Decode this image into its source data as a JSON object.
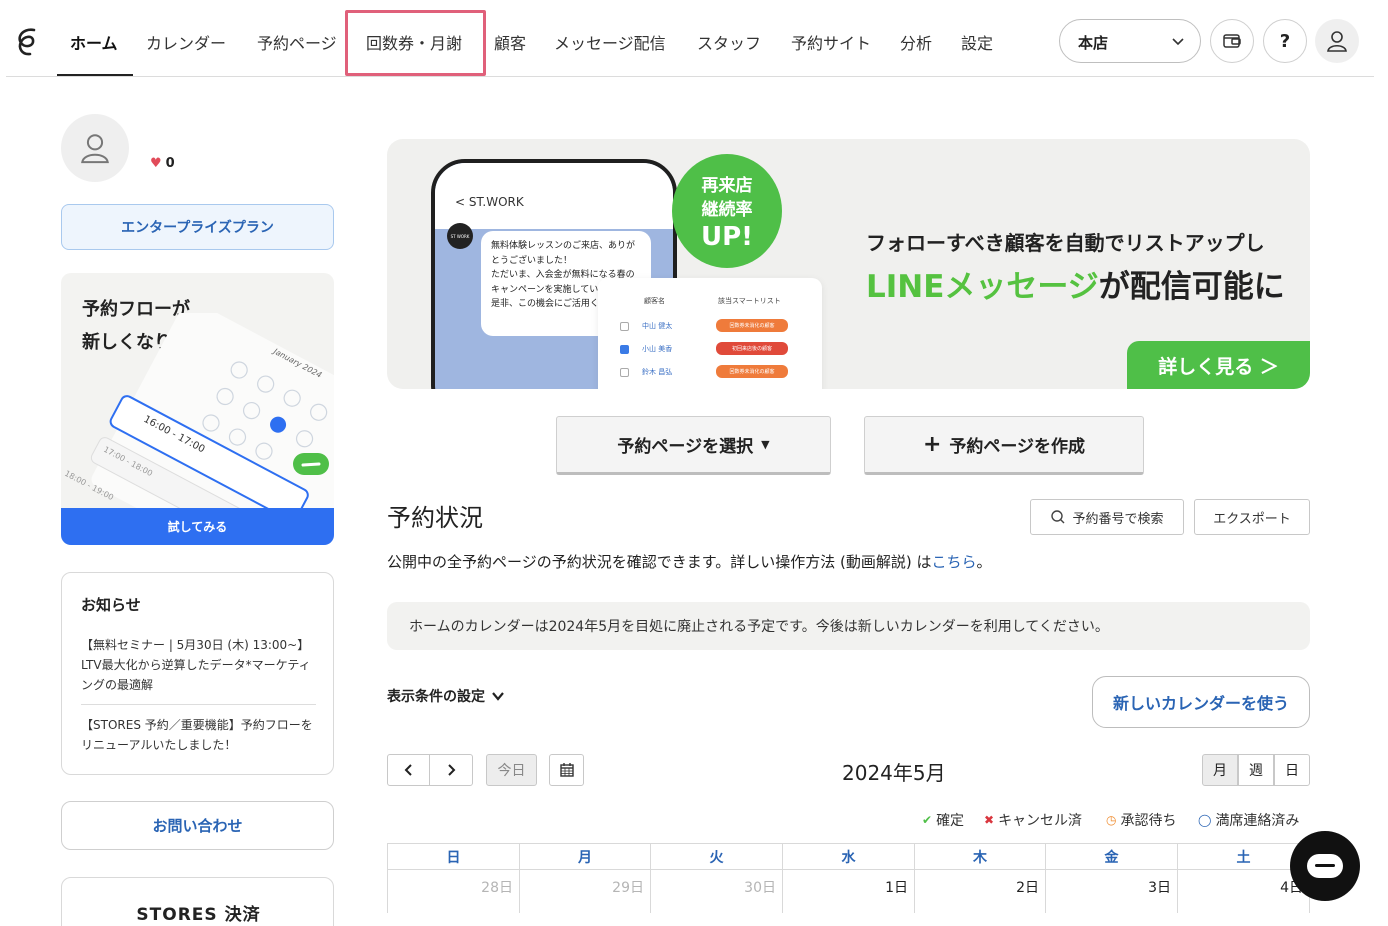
{
  "nav": {
    "items": [
      "ホーム",
      "カレンダー",
      "予約ページ",
      "回数券・月謝",
      "顧客",
      "メッセージ配信",
      "スタッフ",
      "予約サイト",
      "分析",
      "設定"
    ],
    "store_select": "本店",
    "help_label": "?"
  },
  "sidebar": {
    "likes": "0",
    "plan": "エンタープライズプラン",
    "promo": {
      "title_line1": "予約フローが",
      "title_line2": "新しくなりました",
      "art_date": "January 2024",
      "art_slot1": "16:00 - 17:00",
      "art_slot2": "17:00 - 18:00",
      "art_slot3": "18:00 - 19:00",
      "cta": "試してみる"
    },
    "news": {
      "heading": "お知らせ",
      "item1": "【無料セミナー | 5月30日 (木) 13:00~】LTV最大化から逆算したデータ*マーケティングの最適解",
      "item2": "【STORES 予約／重要機能】予約フローをリニューアルいたしました！"
    },
    "contact": "お問い合わせ",
    "stores_card_title": "STORES 決済"
  },
  "banner": {
    "phone_back": "ST.WORK",
    "phone_icon": "ST WORK",
    "bubble_lines": [
      "無料体験レッスンのご来店、ありがとうございました！",
      "ただいま、入会金が無料になる春のキャンペーンを実施しています。",
      "是非、この機会にご活用ください。"
    ],
    "circle_line1": "再来店",
    "circle_line2": "継続率",
    "circle_line3": "UP!",
    "list_head_name": "顧客名",
    "list_head_list": "該当スマートリスト",
    "list_rows": [
      {
        "name": "中山 健太",
        "tag": "回数券未消化の顧客",
        "checked": false,
        "color": "#ef7b3b"
      },
      {
        "name": "小山 美香",
        "tag": "初回来店後の顧客",
        "checked": true,
        "color": "#e04a3a"
      },
      {
        "name": "鈴木 昌弘",
        "tag": "回数券未消化の顧客",
        "checked": false,
        "color": "#ef7b3b"
      }
    ],
    "headline1": "フォローすべき顧客を自動でリストアップし",
    "headline2_green": "LINEメッセージ",
    "headline2_rest": "が配信可能に",
    "more": "詳しく見る ＞"
  },
  "actions": {
    "select_page": "予約ページを選択",
    "create_page": "予約ページを作成"
  },
  "status": {
    "title": "予約状況",
    "search_btn": "予約番号で検索",
    "export_btn": "エクスポート",
    "desc_pre": "公開中の全予約ページの予約状況を確認できます。詳しい操作方法 (動画解説) は",
    "desc_link": "こちら",
    "desc_post": "。",
    "notice": "ホームのカレンダーは2024年5月を目処に廃止される予定です。今後は新しいカレンダーを利用してください。",
    "filter": "表示条件の設定",
    "new_calendar_btn": "新しいカレンダーを使う"
  },
  "calendar": {
    "today": "今日",
    "month": "2024年5月",
    "views": [
      "月",
      "週",
      "日"
    ],
    "legend": {
      "confirmed": "確定",
      "cancelled": "キャンセル済",
      "pending": "承認待ち",
      "full": "満席連絡済み"
    },
    "weekdays": [
      "日",
      "月",
      "火",
      "水",
      "木",
      "金",
      "土"
    ],
    "days": [
      "28日",
      "29日",
      "30日",
      "1日",
      "2日",
      "3日",
      "4日"
    ]
  },
  "colors": {
    "accent": "#2a64b4",
    "green": "#4fbf48",
    "highlight_box": "#e0607a"
  }
}
